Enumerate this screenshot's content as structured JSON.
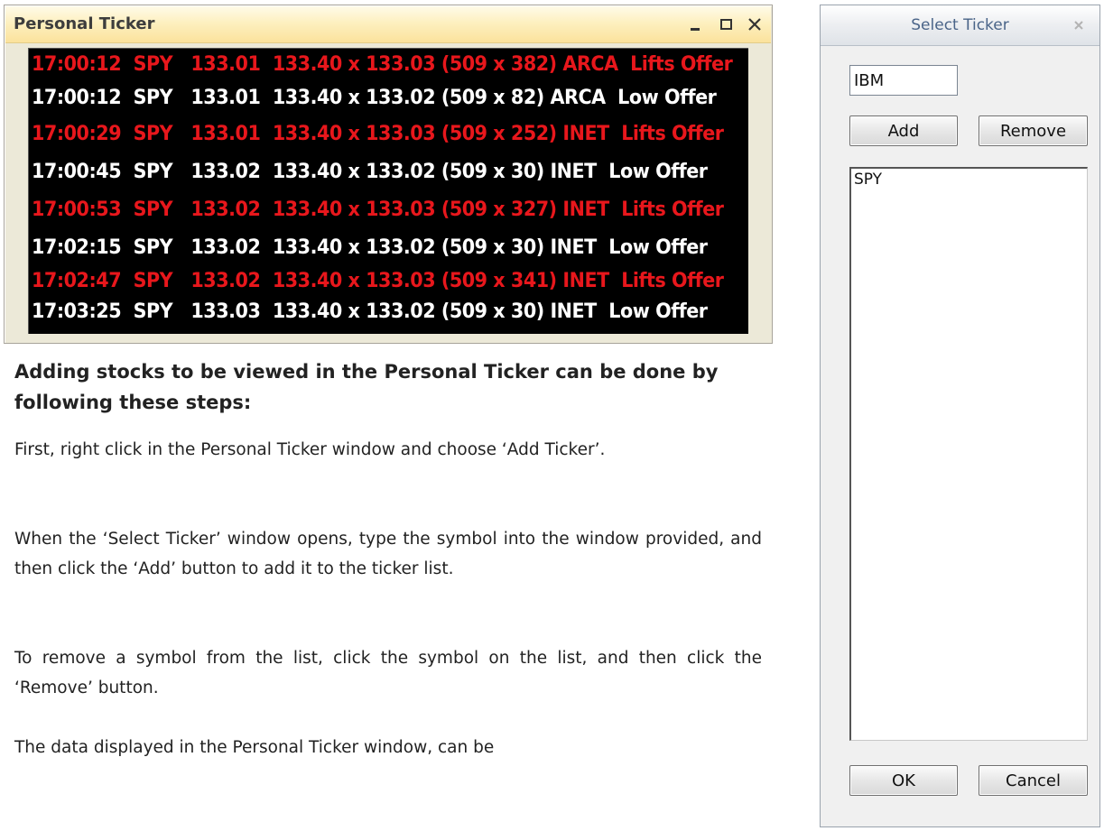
{
  "ticker_window": {
    "title": "Personal Ticker",
    "rows": [
      {
        "text": "17:00:12  SPY   133.01  133.40 x 133.03 (509 x 382) ARCA  Lifts Offer",
        "color": "#e8171c"
      },
      {
        "text": "17:00:12  SPY   133.01  133.40 x 133.02 (509 x 82) ARCA  Low Offer",
        "color": "#ffffff"
      },
      {
        "text": "17:00:29  SPY   133.01  133.40 x 133.03 (509 x 252) INET  Lifts Offer",
        "color": "#e8171c"
      },
      {
        "text": "17:00:45  SPY   133.02  133.40 x 133.02 (509 x 30) INET  Low Offer",
        "color": "#ffffff"
      },
      {
        "text": "17:00:53  SPY   133.02  133.40 x 133.03 (509 x 327) INET  Lifts Offer",
        "color": "#e8171c"
      },
      {
        "text": "17:02:15  SPY   133.02  133.40 x 133.02 (509 x 30) INET  Low Offer",
        "color": "#ffffff"
      },
      {
        "text": "17:02:47  SPY   133.02  133.40 x 133.03 (509 x 341) INET  Lifts Offer",
        "color": "#e8171c"
      },
      {
        "text": "17:03:25  SPY   133.03  133.40 x 133.02 (509 x 30) INET  Low Offer",
        "color": "#ffffff"
      }
    ]
  },
  "instructions": {
    "heading": "Adding stocks to be viewed in the Personal Ticker can be done by following these steps:",
    "paragraphs": [
      "First, right click in the Personal Ticker window and choose ‘Add Ticker’.",
      "When the ‘Select Ticker’ window opens, type the symbol into the window provided, and then click the ‘Add’ button to add it to the ticker list.",
      "To remove a symbol from the list, click the symbol on the list, and then click the ‘Remove’ button.",
      "The data displayed in the Personal Ticker window, can be"
    ]
  },
  "select_ticker": {
    "title": "Select Ticker",
    "input_value": "IBM",
    "add_label": "Add",
    "remove_label": "Remove",
    "list_items": [
      "SPY"
    ],
    "ok_label": "OK",
    "cancel_label": "Cancel"
  }
}
